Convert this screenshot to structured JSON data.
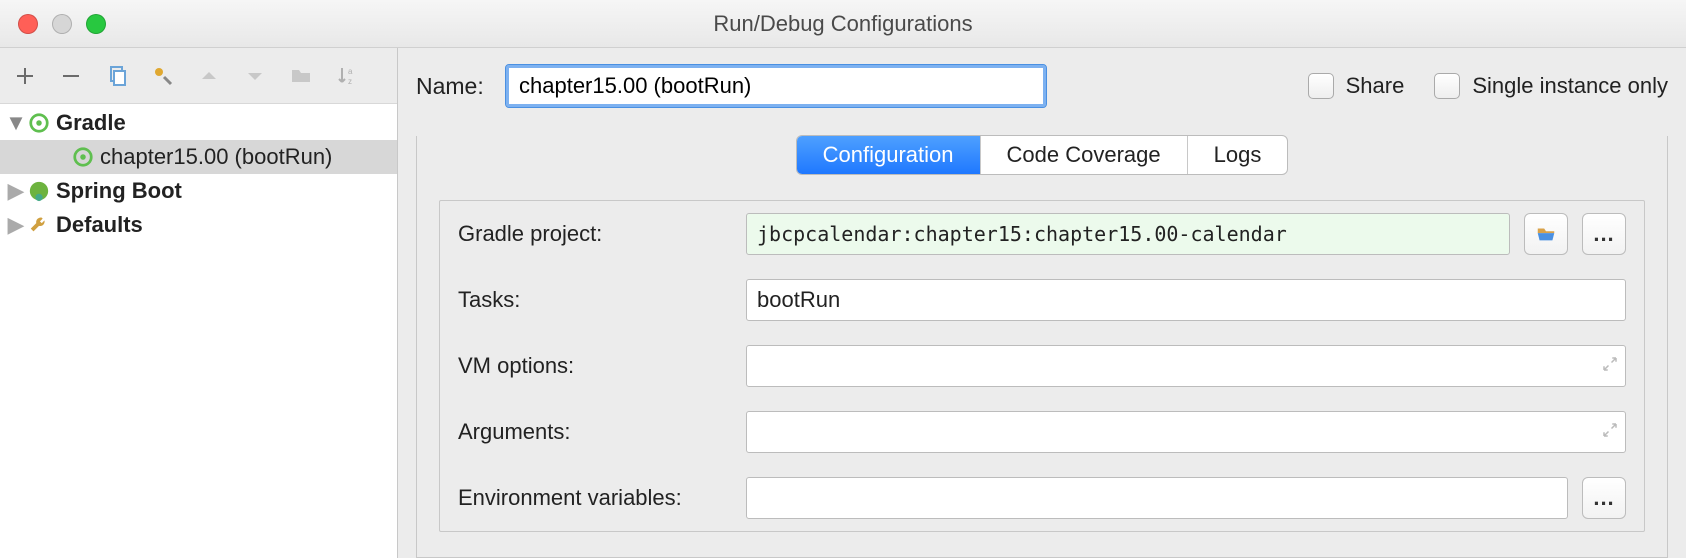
{
  "dialog": {
    "title": "Run/Debug Configurations"
  },
  "nameRow": {
    "label": "Name:",
    "value": "chapter15.00 (bootRun)",
    "share": "Share",
    "singleInstance": "Single instance only"
  },
  "tree": {
    "items": [
      {
        "label": "Gradle",
        "bold": true
      },
      {
        "label": "chapter15.00 (bootRun)",
        "selected": true
      },
      {
        "label": "Spring Boot",
        "bold": true
      },
      {
        "label": "Defaults",
        "bold": true
      }
    ]
  },
  "tabs": {
    "configuration": "Configuration",
    "coverage": "Code Coverage",
    "logs": "Logs"
  },
  "form": {
    "gradleProjectLabel": "Gradle project:",
    "gradleProjectValue": "jbcpcalendar:chapter15:chapter15.00-calendar",
    "tasksLabel": "Tasks:",
    "tasksValue": "bootRun",
    "vmLabel": "VM options:",
    "vmValue": "",
    "argsLabel": "Arguments:",
    "argsValue": "",
    "envLabel": "Environment variables:",
    "envValue": ""
  },
  "buttons": {
    "dots": "..."
  }
}
